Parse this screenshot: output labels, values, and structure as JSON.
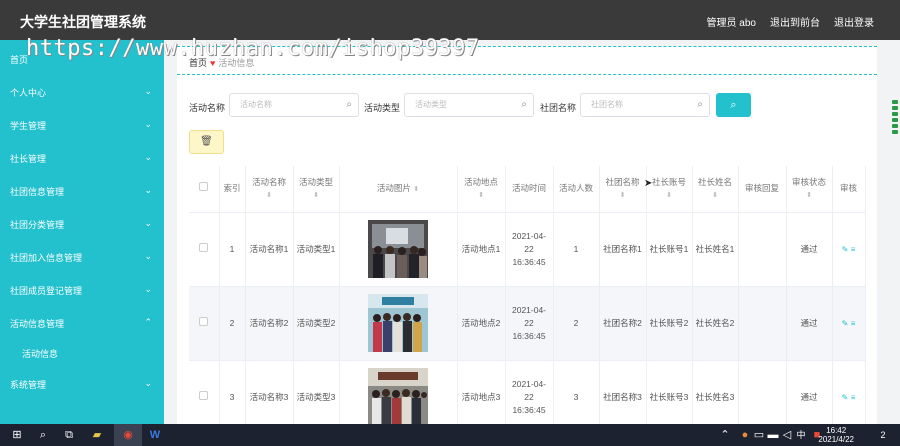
{
  "app": {
    "title": "大学生社团管理系统",
    "user_label": "管理员 abo",
    "back_label": "退出到前台",
    "logout_label": "退出登录"
  },
  "watermark": "https://www.huzhan.com/ishop39397",
  "sidebar": {
    "items": [
      {
        "label": "首页"
      },
      {
        "label": "个人中心"
      },
      {
        "label": "学生管理"
      },
      {
        "label": "社长管理"
      },
      {
        "label": "社团信息管理"
      },
      {
        "label": "社团分类管理"
      },
      {
        "label": "社团加入信息管理"
      },
      {
        "label": "社团成员登记管理"
      },
      {
        "label": "活动信息管理"
      },
      {
        "label": "活动信息"
      },
      {
        "label": "系统管理"
      }
    ]
  },
  "breadcrumb": {
    "home": "首页",
    "current": "活动信息"
  },
  "search": {
    "name_label": "活动名称",
    "name_placeholder": "活动名称",
    "type_label": "活动类型",
    "type_placeholder": "活动类型",
    "club_label": "社团名称",
    "club_placeholder": "社团名称"
  },
  "table": {
    "headers": [
      "索引",
      "活动名称",
      "活动类型",
      "活动图片",
      "活动地点",
      "活动时间",
      "活动人数",
      "社团名称",
      "社长账号",
      "社长姓名",
      "审核回复",
      "审核状态",
      "审核"
    ],
    "rows": [
      {
        "index": "1",
        "name": "活动名称1",
        "type": "活动类型1",
        "place": "活动地点1",
        "time": "2021-04-22 16:36:45",
        "count": "1",
        "club": "社团名称1",
        "account": "社长账号1",
        "leader": "社长姓名1",
        "reply": "",
        "status": "通过"
      },
      {
        "index": "2",
        "name": "活动名称2",
        "type": "活动类型2",
        "place": "活动地点2",
        "time": "2021-04-22 16:36:45",
        "count": "2",
        "club": "社团名称2",
        "account": "社长账号2",
        "leader": "社长姓名2",
        "reply": "",
        "status": "通过"
      },
      {
        "index": "3",
        "name": "活动名称3",
        "type": "活动类型3",
        "place": "活动地点3",
        "time": "2021-04-22 16:36:45",
        "count": "3",
        "club": "社团名称3",
        "account": "社长账号3",
        "leader": "社长姓名3",
        "reply": "",
        "status": "通过"
      }
    ]
  },
  "taskbar": {
    "time": "16:42",
    "date": "2021/4/22",
    "ime": "中",
    "notifications": "2"
  },
  "colors": {
    "accent": "#23c0ce",
    "topbar": "#3a3a3a",
    "taskbar": "#1c2230"
  }
}
